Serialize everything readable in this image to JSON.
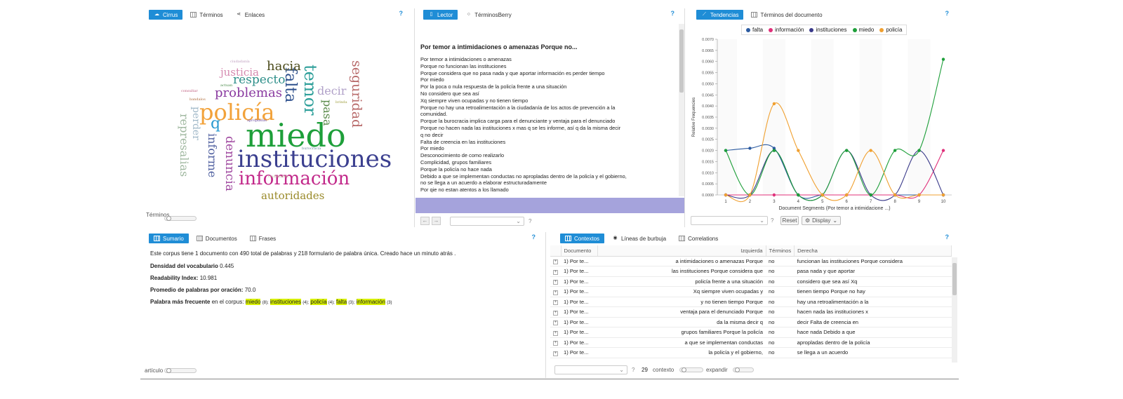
{
  "cirrus": {
    "tabs": [
      {
        "label": "Cirrus",
        "active": true
      },
      {
        "label": "Términos",
        "active": false
      },
      {
        "label": "Enlaces",
        "active": false
      }
    ],
    "help": "?",
    "words": [
      {
        "t": "miedo",
        "c": "#1e9f3a"
      },
      {
        "t": "instituciones",
        "c": "#3b3f8f"
      },
      {
        "t": "policía",
        "c": "#f2a23a"
      },
      {
        "t": "información",
        "c": "#c2298a"
      },
      {
        "t": "falta",
        "c": "#2c4f8c"
      },
      {
        "t": "temor",
        "c": "#2e9f9a"
      },
      {
        "t": "problemas",
        "c": "#8a3aa0"
      },
      {
        "t": "respecto",
        "c": "#2e8f8a"
      },
      {
        "t": "hacia",
        "c": "#4a4a1a"
      },
      {
        "t": "justicia",
        "c": "#d68ab0"
      },
      {
        "t": "autoridades",
        "c": "#9a8a2a"
      },
      {
        "t": "seguridad",
        "c": "#b86a6a"
      },
      {
        "t": "decir",
        "c": "#b0a0c8"
      },
      {
        "t": "pasa",
        "c": "#5a8a4a"
      },
      {
        "t": "denuncia",
        "c": "#a04aa0"
      },
      {
        "t": "informe",
        "c": "#5060a0"
      },
      {
        "t": "q",
        "c": "#2a9ad0"
      },
      {
        "t": "represalias",
        "c": "#a0b8a0"
      },
      {
        "t": "perder",
        "c": "#a0b8c8"
      },
      {
        "t": "ciudadanía",
        "c": "#c0a0c0"
      },
      {
        "t": "consultar",
        "c": "#c06080"
      },
      {
        "t": "bandalos",
        "c": "#b07040"
      },
      {
        "t": "burocracia",
        "c": "#6a8aa0"
      },
      {
        "t": "apropiadas",
        "c": "#6a4aa0"
      },
      {
        "t": "ciudadanos",
        "c": "#c0c0a0"
      },
      {
        "t": "brinda",
        "c": "#a0a040"
      },
      {
        "t": "actuan",
        "c": "#4a8a4a"
      }
    ],
    "slider_label": "Términos"
  },
  "reader": {
    "tabs": [
      {
        "label": "Lector",
        "active": true
      },
      {
        "label": "TérminosBerry",
        "active": false
      }
    ],
    "help": "?",
    "title": "Por temor a intimidaciones o amenazas Porque no...",
    "lines": [
      "Por temor a intimidaciones o amenazas",
      "Porque no funcionan las instituciones",
      "Porque considera que no pasa nada y que aportar información es perder tiempo",
      "Por miedo",
      "Por la poca o nula respuesta de la policía frente a una situación",
      "No considero que sea así",
      "Xq siempre viven ocupadas y no tienen tiempo",
      "Porque no hay una retroalimentación a la ciudadanía de los actos de prevención a la",
      "comunidad.",
      "Porque la burocracia implica carga para el denunciante y ventaja para el denunciado",
      "Porque no hacen nada las instituciones x mas q se les informe, así q da la misma decir",
      "q no decir",
      "Falta de creencia en las instituciones",
      "Por miedo",
      "Desconocimiento de como realizarlo",
      "Complicidad, grupos familiares",
      "Porque la policía no hace nada",
      "Debido a que se implementan conductas no apropladas dentro de la policía y el gobierno,",
      "no se llega a un acuerdo a elaborar estructuradamente",
      "Por qie no estan atentos a los llamado"
    ],
    "nav_help": "?"
  },
  "trends": {
    "tabs": [
      {
        "label": "Tendencias",
        "active": true
      },
      {
        "label": "Términos del documento",
        "active": false
      }
    ],
    "help": "?",
    "reset_label": "Reset",
    "display_label": "Display",
    "help2": "?",
    "colors": {
      "falta": "#2b5aa0",
      "información": "#e0307a",
      "instituciones": "#3a3a8a",
      "miedo": "#1e9f3a",
      "policía": "#f0a030"
    }
  },
  "chart_data": {
    "type": "line",
    "title": "",
    "xlabel": "Document Segments (Por temor a intimidacione ...)",
    "ylabel": "Relative Frequencies",
    "x": [
      1,
      2,
      3,
      4,
      5,
      6,
      7,
      8,
      9,
      10
    ],
    "ylim": [
      0,
      0.007
    ],
    "yticks": [
      "0.0000",
      "0.0005",
      "0.0010",
      "0.0015",
      "0.0020",
      "0.0025",
      "0.0030",
      "0.0035",
      "0.0040",
      "0.0045",
      "0.0050",
      "0.0055",
      "0.0060",
      "0.0065",
      "0.0070"
    ],
    "legend_position": "top",
    "series": [
      {
        "name": "falta",
        "color": "#2b5aa0",
        "values": [
          0.002,
          0.0021,
          0.0021,
          0,
          0,
          0,
          0,
          0,
          0,
          0
        ]
      },
      {
        "name": "información",
        "color": "#e0307a",
        "values": [
          0,
          0,
          0,
          0,
          0,
          0,
          0,
          0,
          0,
          0.002
        ]
      },
      {
        "name": "instituciones",
        "color": "#3a3a8a",
        "values": [
          0,
          0,
          0.002,
          0,
          0,
          0.002,
          0,
          0,
          0.002,
          0
        ]
      },
      {
        "name": "miedo",
        "color": "#1e9f3a",
        "values": [
          0.002,
          0,
          0.002,
          0,
          0,
          0.002,
          0,
          0.002,
          0.002,
          0.0061
        ]
      },
      {
        "name": "policía",
        "color": "#f0a030",
        "values": [
          0,
          0,
          0.0041,
          0.002,
          0,
          0,
          0.002,
          0,
          0,
          0
        ]
      }
    ]
  },
  "summary": {
    "tabs": [
      {
        "label": "Sumario",
        "active": true
      },
      {
        "label": "Documentos",
        "active": false
      },
      {
        "label": "Frases",
        "active": false
      }
    ],
    "help": "?",
    "line1": "Este corpus tiene 1 documento con 490 total de palabras y 218 formulario de palabra única. Creado hace un minuto atrás .",
    "density_label": "Densidad del vocabulario",
    "density_value": "0.445",
    "readability_label": "Readability Index:",
    "readability_value": "10.981",
    "avg_label": "Promedio de palabras por oración:",
    "avg_value": "70.0",
    "freq_label": "Palabra más frecuente",
    "freq_text": "en el corpus:",
    "freq_words": [
      {
        "w": "miedo",
        "n": "(8);"
      },
      {
        "w": "instituciones",
        "n": "(4);"
      },
      {
        "w": "policía",
        "n": "(4);"
      },
      {
        "w": "falta",
        "n": "(3);"
      },
      {
        "w": "información",
        "n": "(3)"
      }
    ],
    "slider_label": "artículo"
  },
  "contexts": {
    "tabs": [
      {
        "label": "Contextos",
        "active": true
      },
      {
        "label": "Líneas de burbuja",
        "active": false
      },
      {
        "label": "Correlations",
        "active": false
      }
    ],
    "help": "?",
    "columns": [
      "Documento",
      "Izquierda",
      "Términos",
      "Derecha"
    ],
    "rows": [
      [
        "1) Por te...",
        "a intimidaciones o amenazas Porque",
        "no",
        "funcionan las instituciones Porque considera"
      ],
      [
        "1) Por te...",
        "las instituciones Porque considera que",
        "no",
        "pasa nada y que aportar"
      ],
      [
        "1) Por te...",
        "policía frente a una situación",
        "no",
        "considero que sea así Xq"
      ],
      [
        "1) Por te...",
        "Xq siempre viven ocupadas y",
        "no",
        "tienen tiempo Porque no hay"
      ],
      [
        "1) Por te...",
        "y no tienen tiempo Porque",
        "no",
        "hay una retroalimentación a la"
      ],
      [
        "1) Por te...",
        "ventaja para el denunciado Porque",
        "no",
        "hacen nada las instituciones x"
      ],
      [
        "1) Por te...",
        "da la misma decir q",
        "no",
        "decir Falta de creencia en"
      ],
      [
        "1) Por te...",
        "grupos familiares Porque la policía",
        "no",
        "hace nada Debido a que"
      ],
      [
        "1) Por te...",
        "a que se implementan conductas",
        "no",
        "apropladas dentro de la policía"
      ],
      [
        "1) Por te...",
        "la policía y el gobierno,",
        "no",
        "se llega a un acuerdo"
      ]
    ],
    "help2": "?",
    "count": "29",
    "context_label": "contexto",
    "expand_label": "expandir"
  }
}
